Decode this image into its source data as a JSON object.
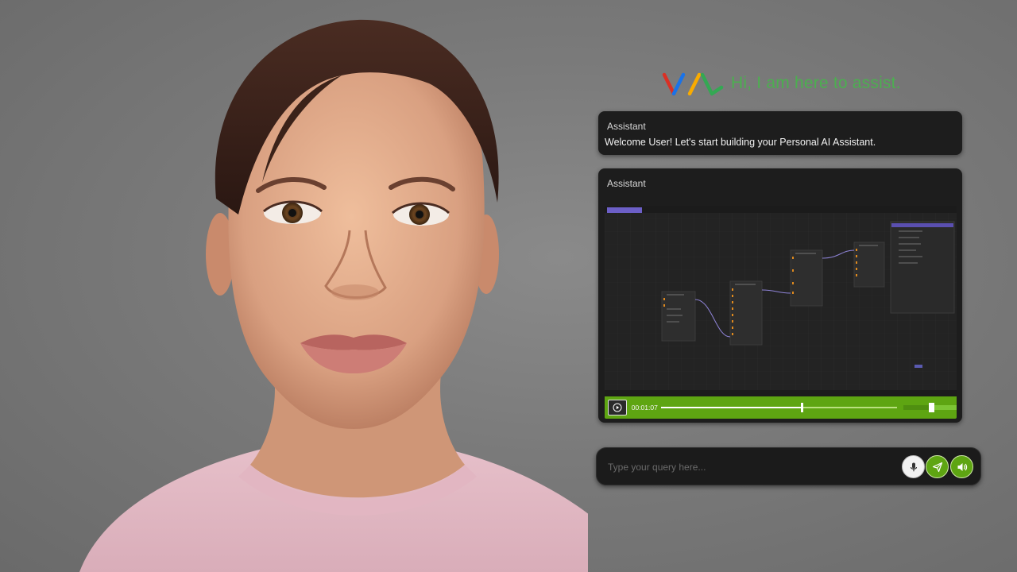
{
  "greeting": {
    "text": "Hi, I am here to assist.",
    "logo_colors": [
      "#d93025",
      "#1a73e8",
      "#f9ab00",
      "#34a853"
    ]
  },
  "message_card": {
    "sender": "Assistant",
    "body": "Welcome User! Let's start building your Personal AI Assistant."
  },
  "video_card": {
    "sender": "Assistant",
    "player": {
      "timestamp": "00:01:07",
      "progress": 0.59,
      "volume": 0.47,
      "play_icon": "play-icon"
    }
  },
  "query_bar": {
    "placeholder": "Type your query here...",
    "value": "",
    "buttons": [
      "microphone-icon",
      "send-icon",
      "speaker-icon"
    ]
  },
  "colors": {
    "accent": "#5ea512",
    "greeting_text": "#4caf50",
    "card_bg": "#1d1d1d",
    "background": "#7a7a7a",
    "node_editor_wire": "#8f84d8"
  }
}
